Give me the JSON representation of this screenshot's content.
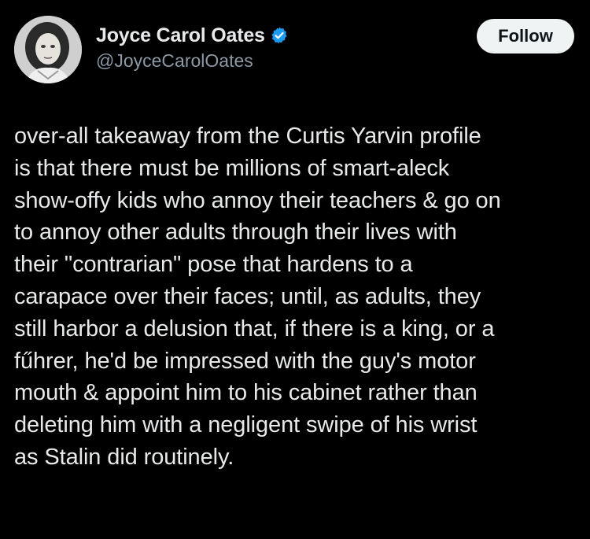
{
  "author": {
    "display_name": "Joyce Carol Oates",
    "handle": "@JoyceCarolOates",
    "verified_icon": "verified-badge-icon",
    "avatar": "author-avatar"
  },
  "actions": {
    "follow_label": "Follow"
  },
  "tweet": {
    "text": "over-all takeaway from the Curtis Yarvin profile\nis that there must be millions of smart-aleck\nshow-offy kids who annoy their teachers & go on\nto annoy other adults through their lives with\ntheir \"contrarian\" pose that hardens to a\ncarapace over their faces; until, as adults, they\nstill harbor a delusion that, if there is a king, or a\nfűhrer, he'd be impressed with the guy's motor\nmouth & appoint him to his cabinet rather than\ndeleting him with a negligent swipe of his wrist\nas Stalin did routinely."
  },
  "colors": {
    "background": "#000000",
    "text": "#e7e9ea",
    "secondary_text": "#8b98a5",
    "verified": "#1d9bf0",
    "button_bg": "#eff3f4"
  }
}
